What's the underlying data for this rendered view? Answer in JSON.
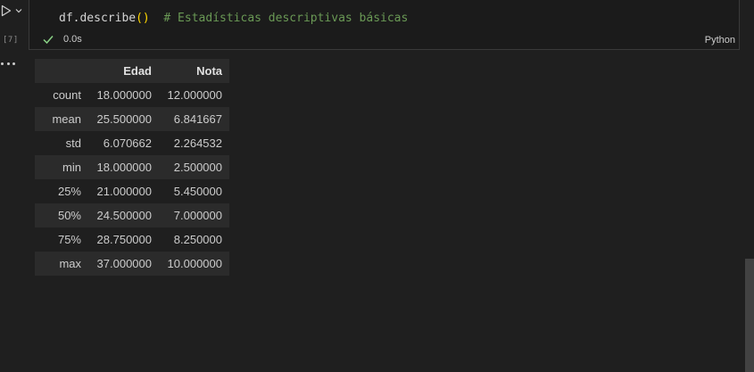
{
  "cell": {
    "execution_count": "[7]",
    "code_call": "df.describe",
    "code_open_paren": "(",
    "code_close_paren": ")",
    "code_comment": "# Estadísticas descriptivas básicas",
    "duration": "0.0s",
    "language": "Python",
    "status_icon": "check-icon",
    "status_color": "#89d185"
  },
  "output": {
    "columns": [
      "",
      "Edad",
      "Nota"
    ],
    "rows": [
      {
        "index": "count",
        "Edad": "18.000000",
        "Nota": "12.000000"
      },
      {
        "index": "mean",
        "Edad": "25.500000",
        "Nota": "6.841667"
      },
      {
        "index": "std",
        "Edad": "6.070662",
        "Nota": "2.264532"
      },
      {
        "index": "min",
        "Edad": "18.000000",
        "Nota": "2.500000"
      },
      {
        "index": "25%",
        "Edad": "21.000000",
        "Nota": "5.450000"
      },
      {
        "index": "50%",
        "Edad": "24.500000",
        "Nota": "7.000000"
      },
      {
        "index": "75%",
        "Edad": "28.750000",
        "Nota": "8.250000"
      },
      {
        "index": "max",
        "Edad": "37.000000",
        "Nota": "10.000000"
      }
    ]
  },
  "icons": {
    "run": "play-icon",
    "run_menu": "chevron-down-icon",
    "output_menu": "more-icon"
  }
}
